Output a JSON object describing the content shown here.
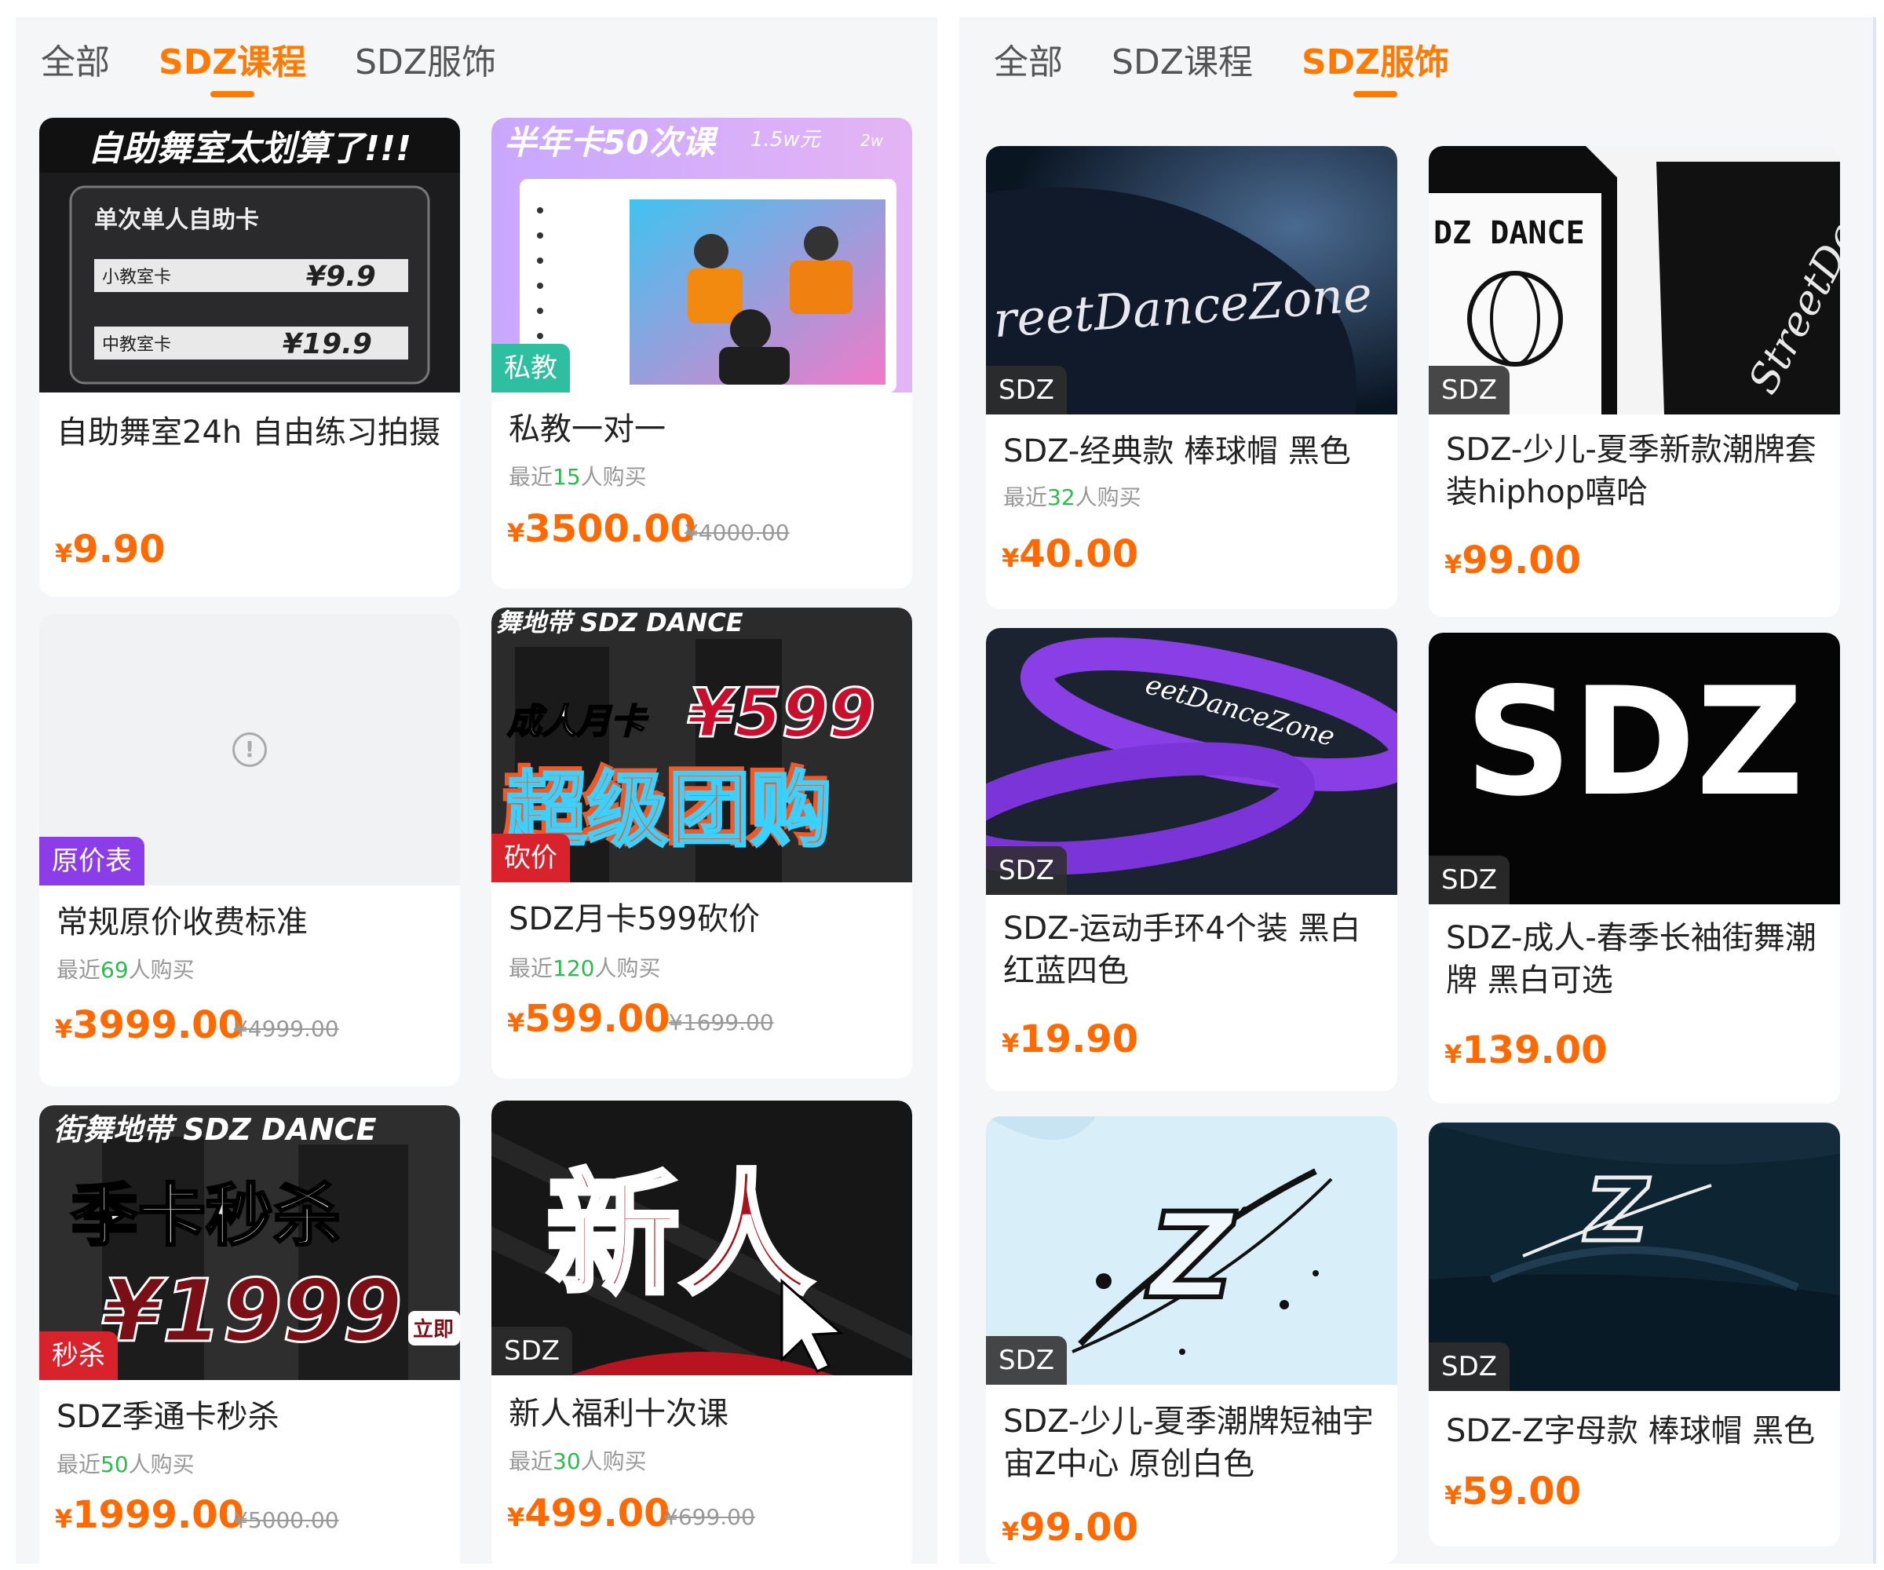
{
  "left_panel": {
    "tabs": [
      {
        "label": "全部",
        "active": false
      },
      {
        "label": "SDZ课程",
        "active": true
      },
      {
        "label": "SDZ服饰",
        "active": false
      }
    ],
    "products": [
      {
        "title": "自助舞室24h 自由练习拍摄",
        "sold_prefix": "",
        "sold_count": "",
        "sold_suffix": "",
        "currency": "¥",
        "price": "9.90",
        "original_price": "",
        "badge": "",
        "image_text": {
          "headline": "自助舞室太划算了!!!",
          "sub": "单次单人自助卡",
          "row1_label": "小教室卡",
          "row1_price": "¥9.9",
          "row2_label": "中教室卡",
          "row2_price": "¥19.9"
        }
      },
      {
        "title": "私教一对一",
        "sold_prefix": "最近",
        "sold_count": "15",
        "sold_suffix": "人购买",
        "currency": "¥",
        "price": "3500.00",
        "original_price": "¥4000.00",
        "badge": "私教",
        "image_text": {
          "headline": "半年卡50次课",
          "tag1": "1.5w元",
          "tag2": "2w"
        }
      },
      {
        "title": "常规原价收费标准",
        "sold_prefix": "最近",
        "sold_count": "69",
        "sold_suffix": "人购买",
        "currency": "¥",
        "price": "3999.00",
        "original_price": "¥4999.00",
        "badge": "原价表",
        "image_text": {
          "placeholder_icon": "info-icon"
        }
      },
      {
        "title": "SDZ月卡599砍价",
        "sold_prefix": "最近",
        "sold_count": "120",
        "sold_suffix": "人购买",
        "currency": "¥",
        "price": "599.00",
        "original_price": "¥1699.00",
        "badge": "砍价",
        "image_text": {
          "top": "舞地带 SDZ DANCE",
          "label": "成人月卡",
          "amount": "¥599",
          "big": "超级团购"
        }
      },
      {
        "title": "SDZ季通卡秒杀",
        "sold_prefix": "最近",
        "sold_count": "50",
        "sold_suffix": "人购买",
        "currency": "¥",
        "price": "1999.00",
        "original_price": "¥5000.00",
        "badge": "秒杀",
        "image_text": {
          "top": "街舞地带 SDZ DANCE",
          "big": "季卡秒杀",
          "amount": "¥1999",
          "side": "立即"
        }
      },
      {
        "title": "新人福利十次课",
        "sold_prefix": "最近",
        "sold_count": "30",
        "sold_suffix": "人购买",
        "currency": "¥",
        "price": "499.00",
        "original_price": "¥699.00",
        "badge": "SDZ",
        "image_text": {
          "big": "新人"
        }
      }
    ]
  },
  "right_panel": {
    "tabs": [
      {
        "label": "全部",
        "active": false
      },
      {
        "label": "SDZ课程",
        "active": false
      },
      {
        "label": "SDZ服饰",
        "active": true
      }
    ],
    "products": [
      {
        "title": "SDZ-经典款 棒球帽 黑色",
        "sold_prefix": "最近",
        "sold_count": "32",
        "sold_suffix": "人购买",
        "currency": "¥",
        "price": "40.00",
        "original_price": "",
        "badge": "SDZ",
        "image_text": {
          "cap_text": "reetDanceZone"
        }
      },
      {
        "title": "SDZ-少儿-夏季新款潮牌套装hiphop嘻哈",
        "sold_prefix": "",
        "sold_count": "",
        "sold_suffix": "",
        "currency": "¥",
        "price": "99.00",
        "original_price": "",
        "badge": "SDZ",
        "image_text": {
          "shirt_text": "DZ DANCE",
          "shorts_text": "StreetDanceZone"
        }
      },
      {
        "title": "SDZ-运动手环4个装 黑白红蓝四色",
        "sold_prefix": "",
        "sold_count": "",
        "sold_suffix": "",
        "currency": "¥",
        "price": "19.90",
        "original_price": "",
        "badge": "SDZ",
        "image_text": {
          "band_text": "eetDanceZone"
        }
      },
      {
        "title": "SDZ-成人-春季长袖街舞潮牌 黑白可选",
        "sold_prefix": "",
        "sold_count": "",
        "sold_suffix": "",
        "currency": "¥",
        "price": "139.00",
        "original_price": "",
        "badge": "SDZ",
        "image_text": {
          "logo": "SDZ"
        }
      },
      {
        "title": "SDZ-少儿-夏季潮牌短袖宇宙Z中心 原创白色",
        "sold_prefix": "",
        "sold_count": "",
        "sold_suffix": "",
        "currency": "¥",
        "price": "99.00",
        "original_price": "",
        "badge": "SDZ",
        "image_text": {
          "logo": "Z"
        }
      },
      {
        "title": "SDZ-Z字母款 棒球帽 黑色",
        "sold_prefix": "",
        "sold_count": "",
        "sold_suffix": "",
        "currency": "¥",
        "price": "59.00",
        "original_price": "",
        "badge": "SDZ",
        "image_text": {
          "logo": "Z"
        }
      }
    ]
  },
  "colors": {
    "accent": "#ff7a00",
    "price": "#ff6a00",
    "sold_count": "#2dba4e",
    "badge_teal": "#2dbfa0",
    "badge_purple": "#8b3ee8",
    "badge_red": "#d9232c",
    "badge_dark": "#2d2d2d"
  }
}
